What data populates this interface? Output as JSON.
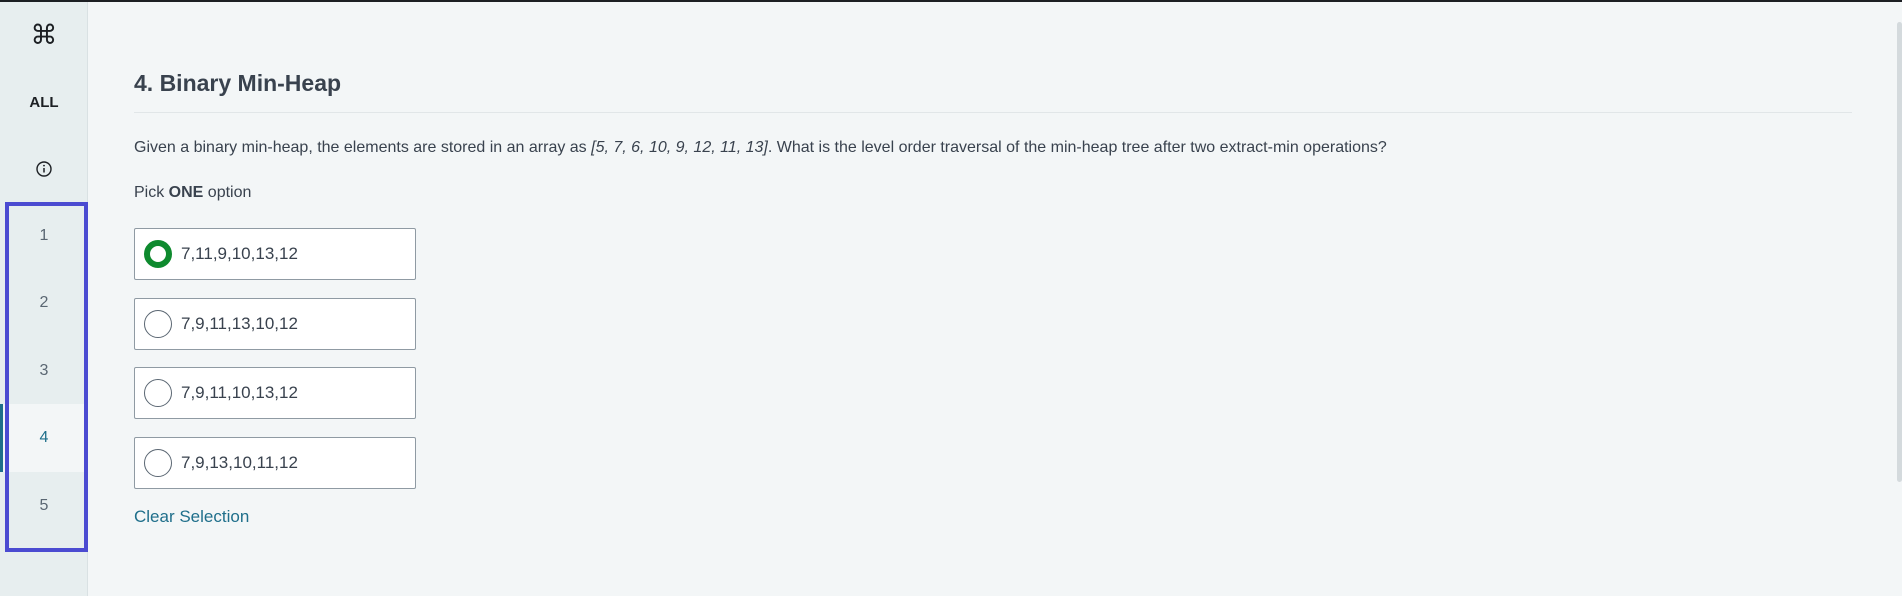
{
  "sidebar": {
    "command_symbol": "⌘",
    "all_label": "ALL",
    "info_icon": "info-circle-icon",
    "questions": [
      "1",
      "2",
      "3",
      "4",
      "5"
    ],
    "active_question": "4",
    "highlight_color": "#4b4bd1"
  },
  "question": {
    "title": "4. Binary Min-Heap",
    "text_before": "Given a binary min-heap, the elements are stored in an array as ",
    "array_text": "[5, 7, 6, 10, 9, 12, 11, 13]",
    "text_after": ". What is the level order traversal of the min-heap tree after two extract-min operations?",
    "pick_prefix": "Pick ",
    "pick_bold": "ONE",
    "pick_suffix": " option",
    "options": [
      {
        "label": "7,11,9,10,13,12",
        "selected": true
      },
      {
        "label": "7,9,11,13,10,12",
        "selected": false
      },
      {
        "label": "7,9,11,10,13,12",
        "selected": false
      },
      {
        "label": "7,9,13,10,11,12",
        "selected": false
      }
    ],
    "clear_label": "Clear Selection"
  },
  "colors": {
    "selected_radio": "#0e8a2e",
    "link": "#1f6f8b",
    "background": "#f3f6f7",
    "sidebar": "#e7eeef"
  }
}
